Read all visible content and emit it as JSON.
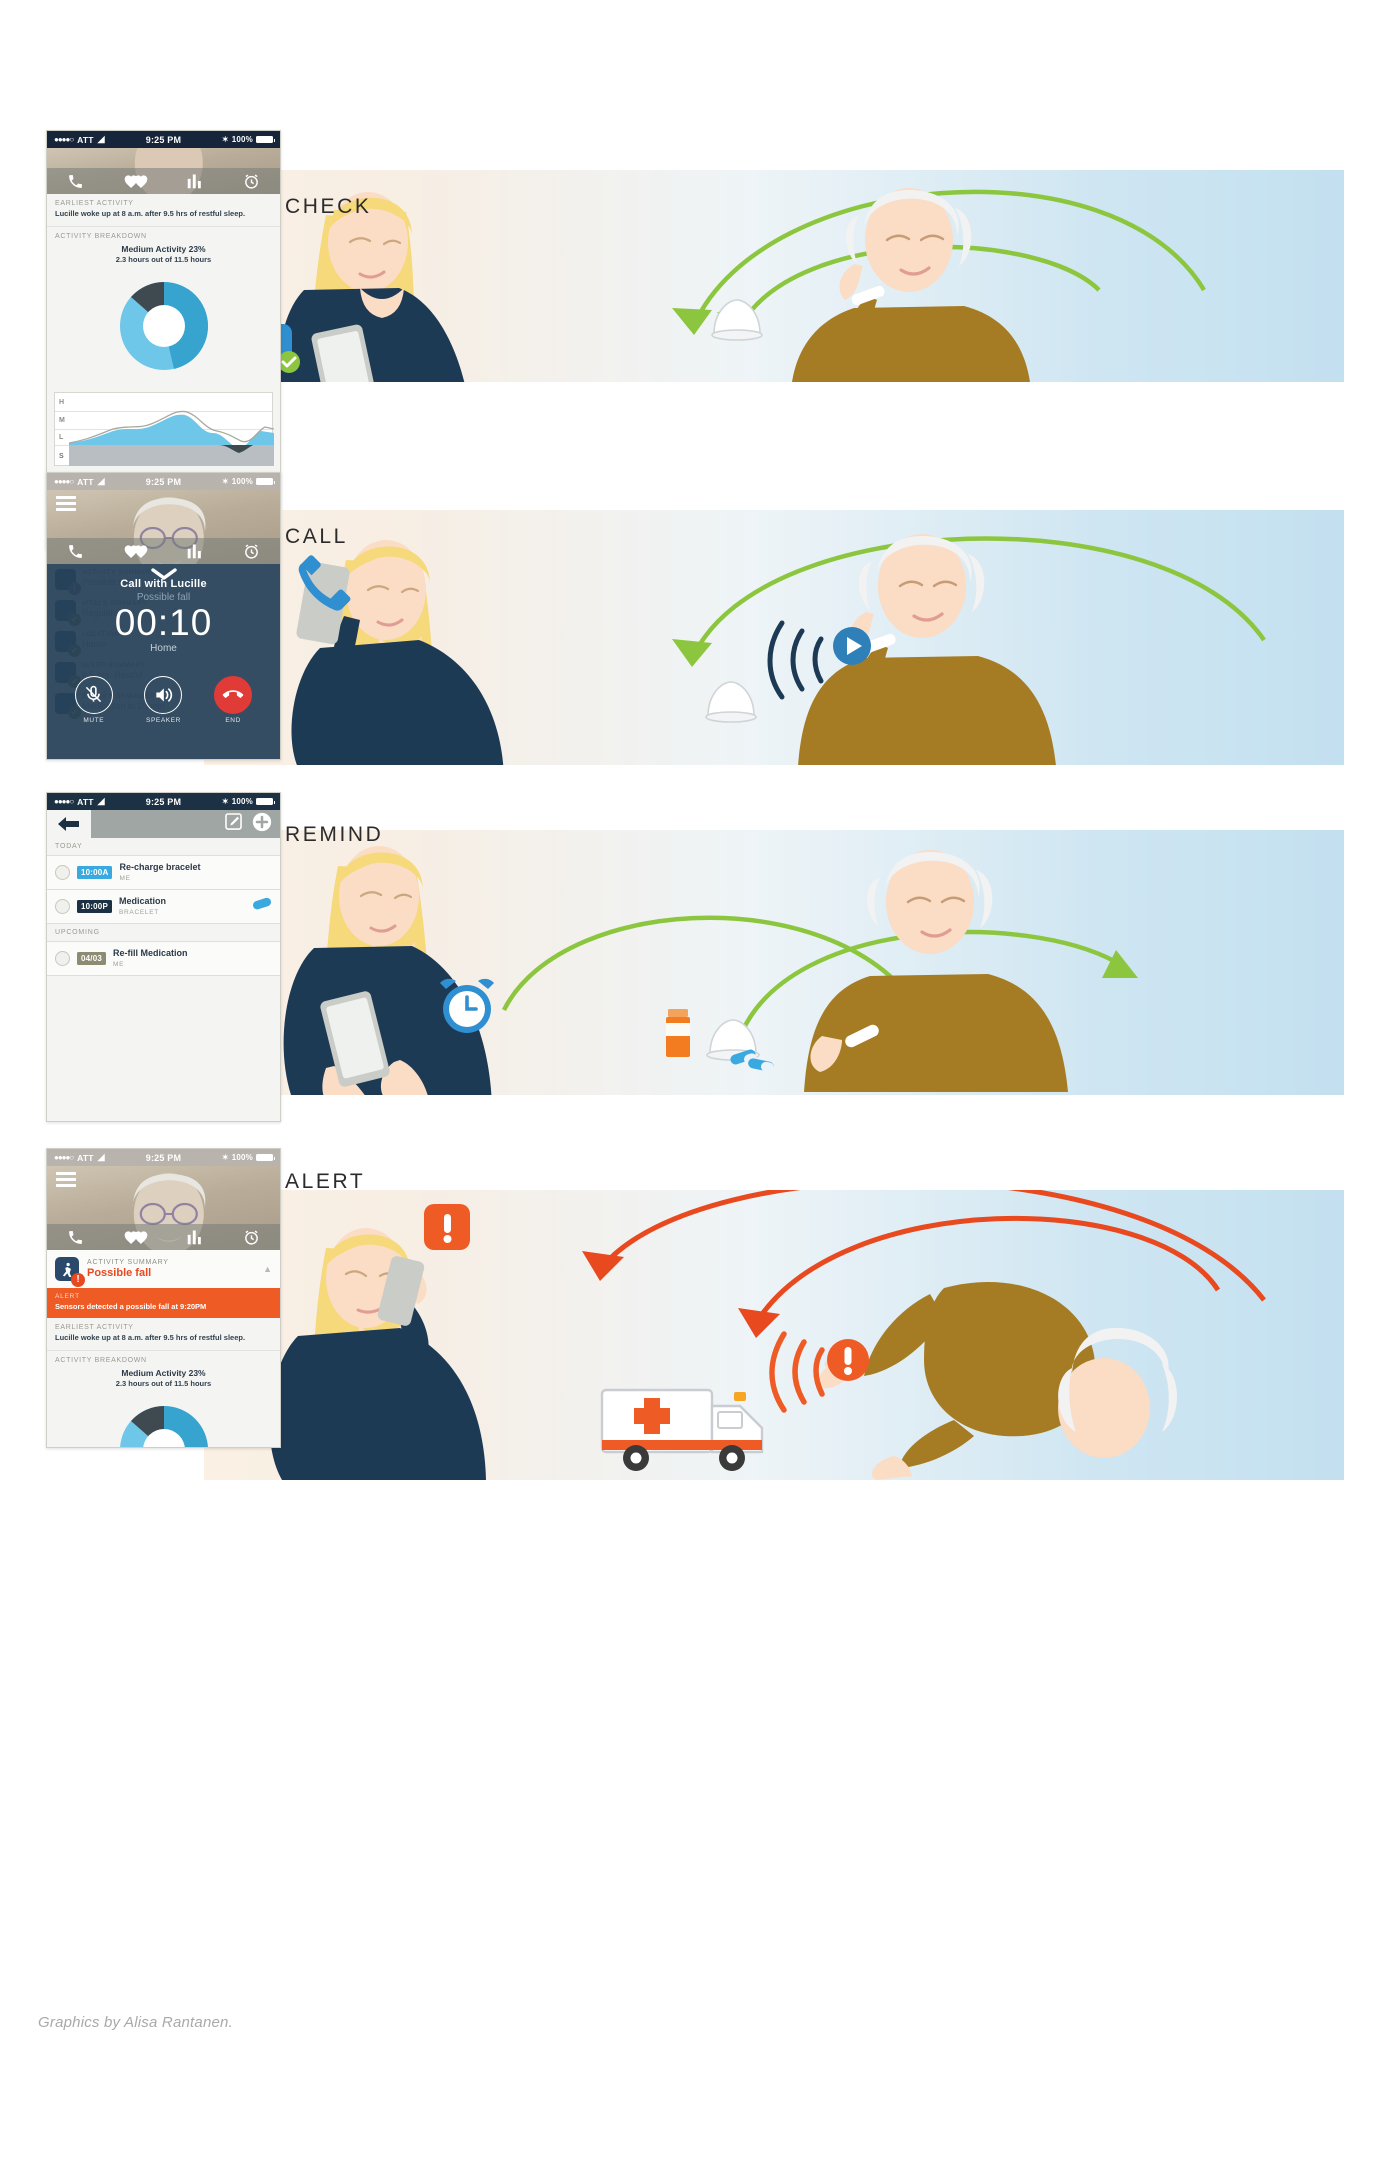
{
  "caption": "Graphics by Alisa Rantanen.",
  "colors": {
    "orange": "#ef5b25",
    "green_arrow": "#8cc63f",
    "blue_dark": "#263f57",
    "blue_light": "#6ec6e8",
    "blue_mid": "#37a3cf",
    "navy_ui": "#1d3144"
  },
  "statusbar": {
    "dots": "●●●●○",
    "carrier": "ATT",
    "wifi": "wifi-icon",
    "time": "9:25 PM",
    "bluetooth": "bluetooth-icon",
    "battery": "100%"
  },
  "tabs": [
    {
      "name": "phone-tab",
      "icon": "phone-icon"
    },
    {
      "name": "hearts-tab",
      "icon": "two-hearts-icon"
    },
    {
      "name": "activity-tab",
      "icon": "bar-chart-icon"
    },
    {
      "name": "reminders-tab",
      "icon": "alarm-clock-icon"
    }
  ],
  "sections": [
    {
      "id": "check",
      "label": "CHECK",
      "phone": {
        "earliest_activity_label": "EARLIEST ACTIVITY",
        "earliest_activity_text": "Lucille woke up at 8 a.m. after 9.5 hrs of restful sleep.",
        "activity_breakdown_label": "ACTIVITY BREAKDOWN",
        "donut_title": "Medium Activity 23%",
        "donut_sub": "2.3 hours out of 11.5 hours",
        "chart_labels": [
          "H",
          "M",
          "L",
          "S"
        ]
      }
    },
    {
      "id": "call",
      "label": "CALL",
      "phone": {
        "call_title": "Call with Lucille",
        "call_sub": "Possible fall",
        "timer": "00:10",
        "location": "Home",
        "buttons": [
          {
            "name": "mute-button",
            "label": "MUTE",
            "icon": "mic-muted-icon"
          },
          {
            "name": "speaker-button",
            "label": "SPEAKER",
            "icon": "speaker-icon"
          },
          {
            "name": "end-call-button",
            "label": "END",
            "icon": "phone-hangup-icon"
          }
        ],
        "ghost_rows": [
          {
            "icon": "walking-person-icon",
            "badge": "!",
            "badge_color": "#6d7d8c",
            "label": "ACTIVITY SUMMARY",
            "value": "Possible fall"
          },
          {
            "icon": "heartbeat-icon",
            "badge": "✓",
            "badge_color": "#6f8c56",
            "label": "VITALS SUMMARY",
            "value": "Regular"
          },
          {
            "icon": "location-pin-icon",
            "badge": "✓",
            "badge_color": "#6f8c56",
            "label": "LOCATION",
            "value": "Home"
          },
          {
            "icon": "sleep-zz-icon",
            "badge": "✓",
            "badge_color": "#6f8c56",
            "label": "SLEEP SUMMARY",
            "value": "9.5 hrs. Restful"
          },
          {
            "icon": "alarm-clock-icon",
            "badge": "✓",
            "badge_color": "#6f8c56",
            "label": "TODAY'S REMINDERS",
            "value": "Medication in 20 min"
          }
        ]
      }
    },
    {
      "id": "remind",
      "label": "REMIND",
      "phone": {
        "back_icon": "back-arrow-icon",
        "edit_icon": "compose-icon",
        "add_icon": "plus-circle-icon",
        "groups": [
          {
            "heading": "TODAY",
            "items": [
              {
                "time": "10:00A",
                "time_color": "#3aa9e0",
                "title": "Re-charge bracelet",
                "who": "ME",
                "pill": false
              },
              {
                "time": "10:00P",
                "time_color": "#1d3144",
                "title": "Medication",
                "who": "BRACELET",
                "pill": true
              }
            ]
          },
          {
            "heading": "UPCOMING",
            "items": [
              {
                "time": "04/03",
                "time_color": "#8d8b72",
                "title": "Re-fill Medication",
                "who": "ME",
                "pill": false
              }
            ]
          }
        ]
      }
    },
    {
      "id": "alert",
      "label": "ALERT",
      "phone": {
        "summary_label": "ACTIVITY SUMMARY",
        "summary_value": "Possible fall",
        "summary_icon": "walking-person-icon",
        "summary_badge": "!",
        "alert_label": "ALERT",
        "alert_text": "Sensors detected a possible fall at 9:20PM",
        "earliest_activity_label": "EARLIEST ACTIVITY",
        "earliest_activity_text": "Lucille woke up at 8 a.m. after 9.5 hrs of restful sleep.",
        "activity_breakdown_label": "ACTIVITY BREAKDOWN",
        "donut_title": "Medium Activity 23%",
        "donut_sub": "2.3 hours out of 11.5 hours"
      }
    }
  ],
  "scene_objects": {
    "check": {
      "app_badge_icon": "walking-person-app-badge",
      "hub_device": "bedside-hub-icon",
      "bracelet": "wrist-bracelet",
      "arrows": [
        "arrow-from-elder-to-caregiver",
        "arrow-from-elder-to-hub"
      ]
    },
    "call": {
      "play_badge_icon": "play-button-badge",
      "sound_waves": "sound-wave-arcs",
      "hub_device": "bedside-hub-icon",
      "phone_in_hand_icon": "phone-handset-icon"
    },
    "remind": {
      "alarm_badge_icon": "alarm-clock-badge",
      "pill_bottle": "medicine-bottle",
      "pills": "capsule-pills",
      "hub_device": "bedside-hub-icon"
    },
    "alert": {
      "alert_badge_icon": "exclamation-badge",
      "ambulance": "ambulance-vehicle",
      "cross_icon": "medical-cross-icon",
      "sound_waves": "alert-wave-arcs"
    }
  }
}
